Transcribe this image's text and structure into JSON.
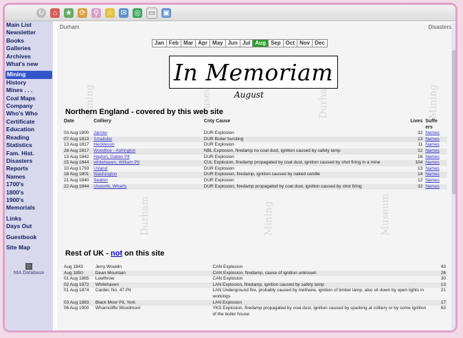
{
  "sidebar": {
    "groups": [
      [
        "Main List",
        "Newsletter",
        "Books",
        "Galleries",
        "Archives",
        "What's new"
      ],
      [
        "Mining",
        "History",
        "Mines . . .",
        "Coal Maps",
        "Company",
        "Who's Who",
        "Certificate",
        "Education",
        "Reading",
        "Statistics",
        "Fam. Hist.",
        "Disasters",
        "Reports",
        "Names",
        "1700's",
        "1800's",
        "1900's",
        "Memorials"
      ],
      [
        "Links",
        "Days Out"
      ],
      [
        "Guestbook"
      ],
      [
        "Site Map"
      ]
    ],
    "active": "Mining",
    "footer": "NIA Database"
  },
  "topbar": {
    "left": "Durham",
    "right": "Disasters"
  },
  "months": [
    "Jan",
    "Feb",
    "Mar",
    "Apr",
    "May",
    "Jun",
    "Jul",
    "Aug",
    "Sep",
    "Oct",
    "Nov",
    "Dec"
  ],
  "selected_month": "Aug",
  "title": "In Memoriam",
  "month_heading": "August",
  "section1": {
    "heading": "Northern England - covered by this web site",
    "columns": [
      "Date",
      "Colliery",
      "Cnty Cause",
      "Lives",
      "Suffe ers"
    ],
    "rows": [
      [
        "03 Aug 1800",
        "Jarrow",
        "DUR Explosion",
        "32",
        "Names"
      ],
      [
        "07 Aug 1813",
        "Smallsfer",
        "DUR Boiler bursting",
        "13",
        "Names"
      ],
      [
        "13 Aug 1817",
        "Heckleson",
        "DUR Explosion",
        "11",
        "Names"
      ],
      [
        "28 Aug 1817",
        "Woodlice - Ashington",
        "NBL Explosion, firedamp no coal dust, ignition caused by safety lamp",
        "12",
        "Names"
      ],
      [
        "13 Aug 1842",
        "Hayton, Gallan Pit",
        "DUR Explosion",
        "16",
        "Names"
      ],
      [
        "15 Aug 1844",
        "whitehaven, William Pit",
        "CUL Explosion, firedamp propagated by coal dust, ignition caused by shot firing in a mine",
        "104",
        "Names"
      ],
      [
        "10 Aug 1793",
        "Usland",
        "DUR Explosion",
        "13",
        "Names"
      ],
      [
        "18 Aug 1801",
        "Washington",
        "DUR Explosion, firedamp, ignition caused by naked candle",
        "14",
        "Names"
      ],
      [
        "21 Aug 1840",
        "Seaton",
        "DUR Explosion",
        "12",
        "Names"
      ],
      [
        "22 Aug 1844",
        "Usworth, Wharfs",
        "DUR Explosion, firedamp propagated by coal dust, ignition caused by shot firing",
        "32",
        "Names"
      ]
    ]
  },
  "section2": {
    "heading_prefix": "Rest of UK - ",
    "heading_link": "not",
    "heading_suffix": " on this site",
    "rows": [
      [
        "Aug 1843",
        "Jerry Wouldn",
        "CAN Explosion",
        "43"
      ],
      [
        "Aug 1850",
        "Dean Mountain",
        "CAN Explosion, firedamp, cause of ignition unknown",
        "26"
      ],
      [
        "01 Aug 1865",
        "Lowthrow",
        "CAN Explosion",
        "30"
      ],
      [
        "02 Aug 1872",
        "Whitehaven",
        "LAN Explosion, firedamp, ignition caused by safety lamp",
        "13"
      ],
      [
        "01 Aug 1874",
        "Carder, No. 47 Pit",
        "LAN Underground fire, probably caused by methane, ignition of timber lamp, also sit down by open lights in workings",
        "21"
      ],
      [
        "03 Aug 1883",
        "Black Moor Pit, York",
        "LAN Explosion",
        "17"
      ],
      [
        "06 Aug 1900",
        "Wharncliffe Woodmoor",
        "YKS Explosion, firedamp propagated by coal dust, ignition caused by sparking at colliery or by some ignition of the boiler house",
        "63"
      ]
    ]
  },
  "watermarks": [
    "Mining",
    "Durham",
    "Museum",
    "Mining",
    "Durham",
    "Museum",
    "Mining"
  ]
}
